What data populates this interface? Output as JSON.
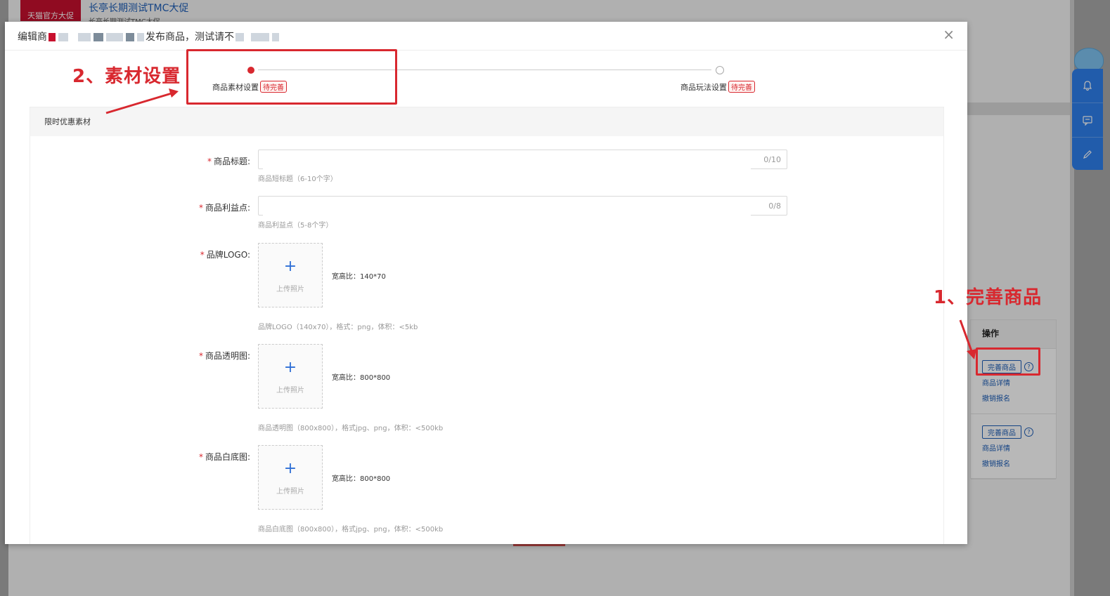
{
  "background": {
    "banner_text": "天猫官方大促",
    "title": "长亭长期测试TMC大促",
    "subtitle": "长亭长期测试TMC大促",
    "table_header": "操作",
    "rows": [
      {
        "complete_btn": "完善商品",
        "detail_link": "商品详情",
        "cancel_link": "撤销报名"
      },
      {
        "complete_btn": "完善商品",
        "detail_link": "商品详情",
        "cancel_link": "撤销报名"
      }
    ]
  },
  "annotations": {
    "step1": "1、完善商品",
    "step2": "2、素材设置"
  },
  "modal": {
    "title_prefix": "编辑商",
    "title_middle": "发布商品，测试请不",
    "close_glyph": "×",
    "steps": [
      {
        "label": "商品素材设置",
        "tag": "待完善",
        "active": true
      },
      {
        "label": "商品玩法设置",
        "tag": "待完善",
        "active": false
      }
    ],
    "section_title": "限时优惠素材",
    "fields": {
      "title": {
        "label": "商品标题:",
        "counter": "0/10",
        "hint": "商品短标题（6-10个字）",
        "value": ""
      },
      "benefit": {
        "label": "商品利益点:",
        "counter": "0/8",
        "hint": "商品利益点（5-8个字）",
        "value": ""
      },
      "logo": {
        "label": "品牌LOGO:",
        "upload_text": "上传照片",
        "ratio": "宽高比：140*70",
        "hint": "品牌LOGO（140x70），格式：png，体积：<5kb"
      },
      "transparent": {
        "label": "商品透明图:",
        "upload_text": "上传照片",
        "ratio": "宽高比：800*800",
        "hint": "商品透明图（800x800），格式jpg、png，体积：<500kb"
      },
      "white": {
        "label": "商品白底图:",
        "upload_text": "上传照片",
        "ratio": "宽高比：800*800",
        "hint": "商品白底图（800x800），格式jpg、png，体积：<500kb"
      }
    },
    "required_mark": "*",
    "plus_glyph": "+"
  },
  "icons": {
    "bell": "bell-icon",
    "chat": "chat-icon",
    "edit": "edit-icon",
    "help": "?"
  },
  "colors": {
    "accent_red": "#d8282f",
    "link_blue": "#1d5eb8",
    "toolbar_blue": "#2f80ed"
  }
}
